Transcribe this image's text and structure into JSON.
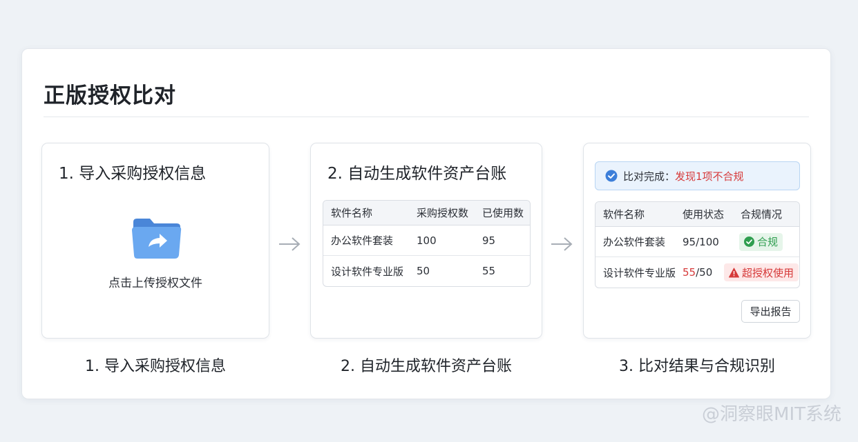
{
  "page": {
    "title": "正版授权比对",
    "watermark": "@洞察眼MIT系统"
  },
  "step1": {
    "title": "1. 导入采购授权信息",
    "upload_label": "点击上传授权文件",
    "caption": "1. 导入采购授权信息",
    "icon": "folder-upload-icon"
  },
  "step2": {
    "title": "2. 自动生成软件资产台账",
    "caption": "2. 自动生成软件资产台账",
    "table": {
      "headers": [
        "软件名称",
        "采购授权数",
        "已使用数"
      ],
      "rows": [
        [
          "办公软件套装",
          "100",
          "95"
        ],
        [
          "设计软件专业版",
          "50",
          "55"
        ]
      ]
    }
  },
  "step3": {
    "caption": "3. 比对结果与合规识别",
    "banner": {
      "prefix": "比对完成：",
      "alert": "发现1项不合规",
      "icon": "check-circle-icon"
    },
    "table": {
      "headers": [
        "软件名称",
        "使用状态",
        "合规情况"
      ],
      "rows": [
        {
          "name": "办公软件套装",
          "used": "95",
          "total": "/100",
          "status": "合规",
          "ok": true
        },
        {
          "name": "设计软件专业版",
          "used": "55",
          "total": "/50",
          "status": "超授权使用",
          "ok": false
        }
      ]
    },
    "export_label": "导出报告"
  },
  "colors": {
    "accent": "#3d7fd9",
    "ok": "#2f9e4f",
    "alert": "#d63a3a",
    "folder": "#5b9bea"
  }
}
